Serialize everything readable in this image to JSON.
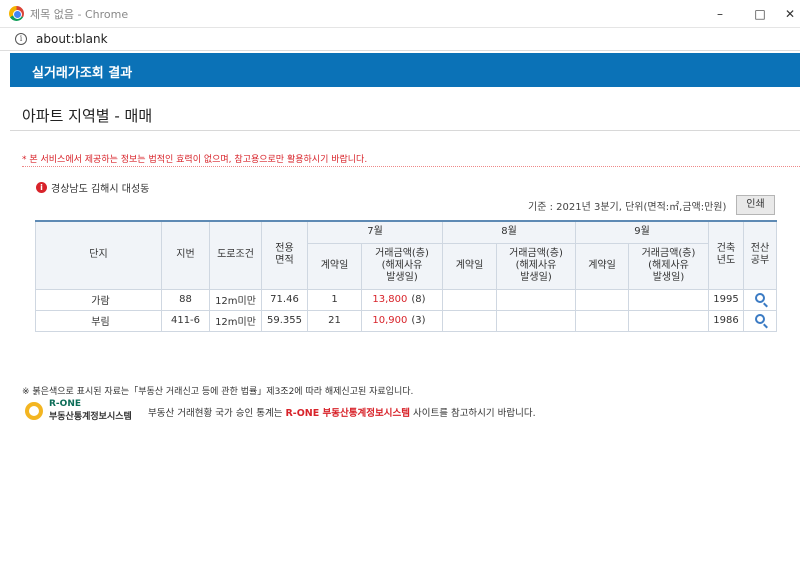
{
  "window": {
    "title": "제목 없음 - Chrome",
    "minimize_glyph": "–",
    "maximize_glyph": "□",
    "close_glyph": "✕"
  },
  "address": {
    "url": "about:blank",
    "info_glyph": "i"
  },
  "header": {
    "title": "실거래가조회 결과"
  },
  "page_subtitle": "아파트 지역별 - 매매",
  "notice": "* 본 서비스에서 제공하는 정보는 법적인 효력이 없으며, 참고용으로만 활용하시기 바랍니다.",
  "location": {
    "icon_glyph": "i",
    "text": "경상남도 김해시 대성동"
  },
  "basis": "기준 : 2021년 3분기, 단위(면적:㎡,금액:만원)",
  "print_label": "인쇄",
  "table": {
    "headers": {
      "complex": "단지",
      "lot": "지번",
      "road": "도로조건",
      "area": "전용\n면적",
      "month7": "7월",
      "month8": "8월",
      "month9": "9월",
      "contract_day": "계약일",
      "amount": "거래금액(층)\n(해제사유\n발생일)",
      "build_year": "건축\n년도",
      "register": "전산\n공부"
    },
    "rows": [
      {
        "name": "가람",
        "lot": "88",
        "road": "12m미만",
        "area": "71.46",
        "day7": "1",
        "amount7": "13,800",
        "floor7": "(8)",
        "year": "1995"
      },
      {
        "name": "부림",
        "lot": "411-6",
        "road": "12m미만",
        "area": "59.355",
        "day7": "21",
        "amount7": "10,900",
        "floor7": "(3)",
        "year": "1986"
      }
    ]
  },
  "footnote": "※ 붉은색으로 표시된 자료는「부동산 거래신고 등에 관한 법률」제3조2에 따라 해제신고된 자료입니다.",
  "rone": {
    "logo_title": "R-ONE",
    "logo_sub": "부동산통계정보시스템",
    "text_before": "부동산 거래현황 국가 승인 통계는 ",
    "text_highlight": "R-ONE 부동산통계정보시스템",
    "text_after": " 사이트를 참고하시기 바랍니다."
  }
}
